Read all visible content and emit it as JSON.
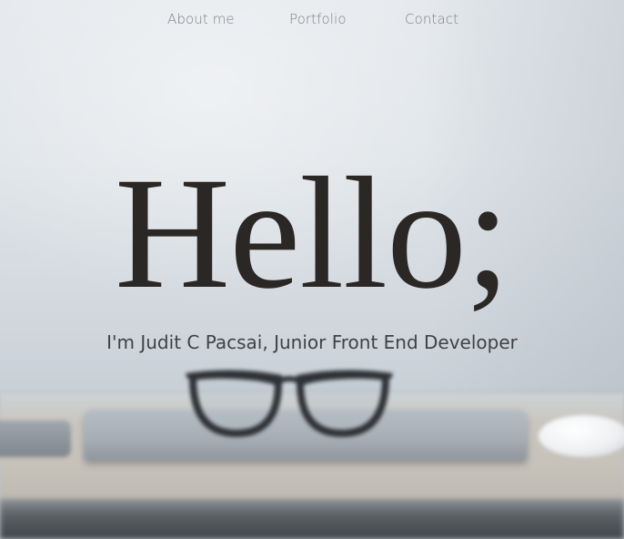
{
  "nav": {
    "items": [
      {
        "label": "About me"
      },
      {
        "label": "Portfolio"
      },
      {
        "label": "Contact"
      }
    ]
  },
  "hero": {
    "headline": "Hello;",
    "subtitle": "I'm Judit C Pacsai, Junior Front End Developer",
    "background_image": "blurred-desk-with-glasses-and-laptop"
  },
  "colors": {
    "headline": "#2b2725",
    "subtitle": "#3f4246",
    "nav_link": "#7c7f83",
    "background": "#e4e8ec"
  }
}
